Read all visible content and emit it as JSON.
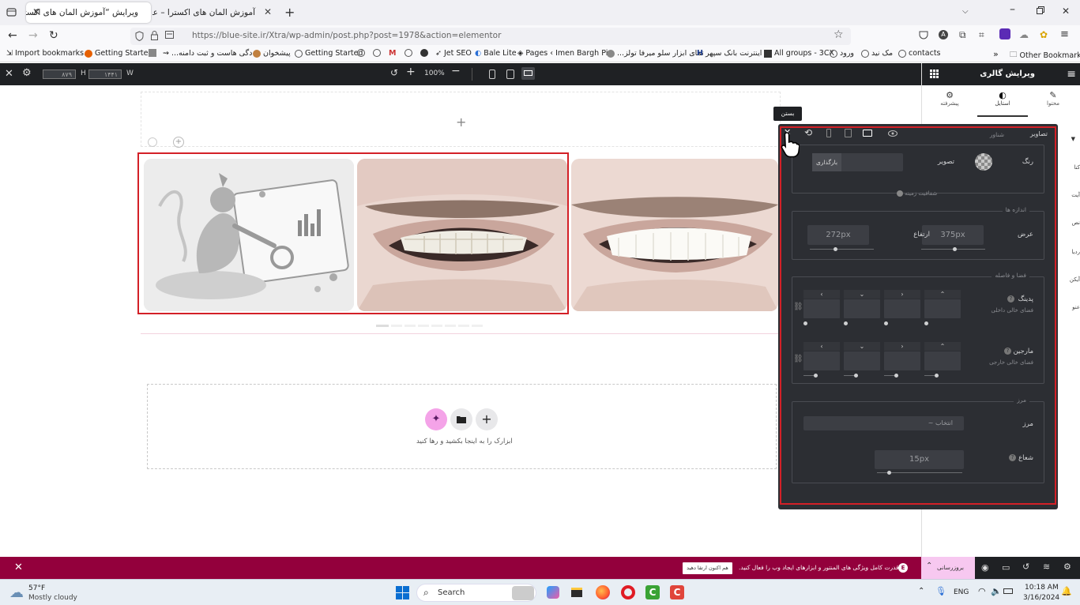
{
  "browser": {
    "tabs": [
      {
        "title": "ویرایش “آموزش المان های اکسترا – ع",
        "active": true
      },
      {
        "title": "آموزش المان های اکسترا – علاءالدین",
        "active": false
      }
    ],
    "url": "https://blue-site.ir/Xtra/wp-admin/post.php?post=1978&action=elementor",
    "bookmarks": [
      "Import bookmarks...",
      "Getting Started",
      "...دگی هاست و ثبت دامنه",
      "پیشخوان",
      "Getting Started",
      "Jet SEO",
      "Bale Lite",
      "Pages ‹ Imen Bargh Pi...",
      "...تمای ابزار سلو میرفا تولز",
      "اینترنت بانک سپهر",
      "All groups - 3CX",
      "ورود",
      "مک نید",
      "contacts"
    ],
    "other_bookmarks": "Other Bookmarks"
  },
  "editor_top": {
    "width_value": "۸۷۹",
    "height_value": "۱۴۴۱",
    "w_label": "W",
    "h_label": "H",
    "zoom": "100%"
  },
  "panel": {
    "title": "ویرایش گالری",
    "tabs": [
      "محتوا",
      "استایل",
      "پیشرفته"
    ],
    "side_letters": [
      "کنا",
      "آیت",
      "نص",
      "ردیا",
      "آیکن",
      "عنو"
    ]
  },
  "canvas": {
    "drop_text": "ابزارک را به اینجا بکشید و رها کنید"
  },
  "popover": {
    "tooltip": "بستن",
    "title": "تصاویر",
    "state": "شناور",
    "color_label": "رنگ",
    "image_label": "تصویر",
    "upload_label": "بارگذاری",
    "bg_note": "شفافیت زمینه",
    "dimensions_section": "اندازه ها",
    "width_label": "عرض",
    "width_value": "375px",
    "width_fill": 0.52,
    "height_label": "ارتفاع",
    "height_value": "272px",
    "height_fill": 0.39,
    "spacing_section": "فضا و فاصله",
    "padding_label": "پدینگ",
    "padding_sub": "فضای خالی داخلی",
    "margin_label": "مارجین",
    "margin_sub": "فضای خالی خارجی",
    "border_section": "مرز",
    "border_label": "مرز",
    "border_select": "انتخاب ~",
    "radius_label": "شعاع",
    "radius_value": "15px",
    "radius_fill": 0.14
  },
  "notice": {
    "text": "قدرت کامل ویژگی های المنتور و ابزارهای ایجاد وب را فعال کنید.",
    "cta": "هم اکنون ارتقا دهید",
    "upgrade": "بروزرسانی"
  },
  "taskbar": {
    "temp": "57°F",
    "weather": "Mostly cloudy",
    "search": "Search",
    "lang": "ENG",
    "time": "10:18 AM",
    "date": "3/16/2024"
  },
  "colors": {
    "accent": "#d32027",
    "notice": "#93003c",
    "panel_dark": "#1f2124"
  }
}
